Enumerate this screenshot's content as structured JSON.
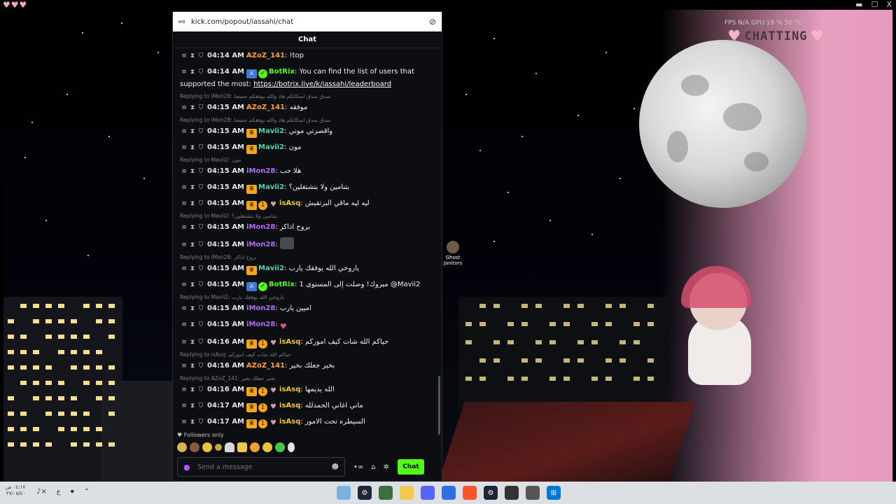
{
  "title_hearts": "♥♥♥",
  "window_controls": {
    "minimize": "▬",
    "maximize": "☐",
    "close": "X"
  },
  "overlay": {
    "fps_label": "FPS  N/A        GPU  19 %  50 °C",
    "chatting_label": "CHATTING",
    "heart": "♥"
  },
  "desktop_icon": {
    "label_line1": "Ghost",
    "label_line2": "Janitors"
  },
  "browser": {
    "url": "kick.com/popout/iassahi/chat",
    "tune_icon": "⚯",
    "eye_icon": "⊘"
  },
  "chat": {
    "title": "Chat",
    "messages": [
      {
        "time": "04:14 AM",
        "user": "AZoZ_141",
        "color": "orange",
        "text": "!top"
      },
      {
        "time": "04:14 AM",
        "user": "BotRix",
        "color": "green",
        "badges": [
          "mod",
          "ver"
        ],
        "text": "You can find the list of users that supported the most: ",
        "link": "https://botrix.live/k/iassahi/leaderboard"
      },
      {
        "reply": "Replying to iMon28: صدق صدق اسكاتكم هاد والله يوفقكم جميعنا",
        "time": "04:15 AM",
        "user": "AZoZ_141",
        "color": "orange",
        "text": "موفقه"
      },
      {
        "reply": "Replying to iMon28: صدق صدق اسكاتكم هاد والله يوفقكم جميعنا",
        "time": "04:15 AM",
        "user": "Mavii2",
        "color": "teal",
        "badges": [
          "crown"
        ],
        "text": "واقصرتي موني"
      },
      {
        "time": "04:15 AM",
        "user": "Mavii2",
        "color": "teal",
        "badges": [
          "crown"
        ],
        "text": "مون"
      },
      {
        "reply": "Replying to Mavii2: مون",
        "time": "04:15 AM",
        "user": "iMon28",
        "color": "purple",
        "text": "هلا حب"
      },
      {
        "time": "04:15 AM",
        "user": "Mavii2",
        "color": "teal",
        "badges": [
          "crown"
        ],
        "text": "بتنامين ولا بتشتغلين؟"
      },
      {
        "time": "04:15 AM",
        "user": "isAsq",
        "color": "yellow",
        "badges": [
          "crown",
          "one",
          "heart"
        ],
        "text": "ليه ليه ماقي البرتقيش"
      },
      {
        "reply": "Replying to Mavii2: بتنامين ولا بتشتغلين؟",
        "time": "04:15 AM",
        "user": "iMon28",
        "color": "purple",
        "text": "بروح اذاكر"
      },
      {
        "time": "04:15 AM",
        "user": "iMon28",
        "color": "purple",
        "emote": true,
        "text": ""
      },
      {
        "reply": "Replying to iMon28: بروح اذاكر",
        "time": "04:15 AM",
        "user": "Mavii2",
        "color": "teal",
        "badges": [
          "crown"
        ],
        "text": "ياروحي الله يوفقك يارب"
      },
      {
        "time": "04:15 AM",
        "user": "BotRix",
        "color": "green",
        "badges": [
          "mod",
          "ver"
        ],
        "text": "مبروك! وصلت إلى المستوى 1 @Mavii2"
      },
      {
        "reply": "Replying to Mavii2: ياروحي الله يوفقك يارب",
        "time": "04:15 AM",
        "user": "iMon28",
        "color": "purple",
        "text": "اميين يارب"
      },
      {
        "time": "04:15 AM",
        "user": "iMon28",
        "color": "purple",
        "pink": "♥",
        "text": ""
      },
      {
        "time": "04:16 AM",
        "user": "isAsq",
        "color": "yellow",
        "badges": [
          "crown",
          "one",
          "heart"
        ],
        "text": "حياكم الله شات كيف اموركم"
      },
      {
        "reply": "Replying to isAsq: حياكم الله شات كيف اموركم",
        "time": "04:16 AM",
        "user": "AZoZ_141",
        "color": "orange",
        "text": "بخير جعلك بخير"
      },
      {
        "reply": "Replying to AZoZ_141: بخير جعلك بخير",
        "time": "04:16 AM",
        "user": "isAsq",
        "color": "yellow",
        "badges": [
          "crown",
          "one",
          "heart"
        ],
        "text": "الله يديمها"
      },
      {
        "time": "04:17 AM",
        "user": "isAsq",
        "color": "yellow",
        "badges": [
          "crown",
          "one",
          "heart"
        ],
        "text": "ماني اغاني الحمدلله"
      },
      {
        "time": "04:17 AM",
        "user": "isAsq",
        "color": "yellow",
        "badges": [
          "crown",
          "one",
          "heart"
        ],
        "text": "السيطره تحت الامور"
      }
    ],
    "followers_only": "Followers only",
    "send_placeholder": "Send a message",
    "chat_button": "Chat"
  },
  "taskbar": {
    "clock_line1": "٠٤:١٧ ص",
    "clock_line2": "٢٧/٠٥/٤٠",
    "lang": "ع"
  }
}
